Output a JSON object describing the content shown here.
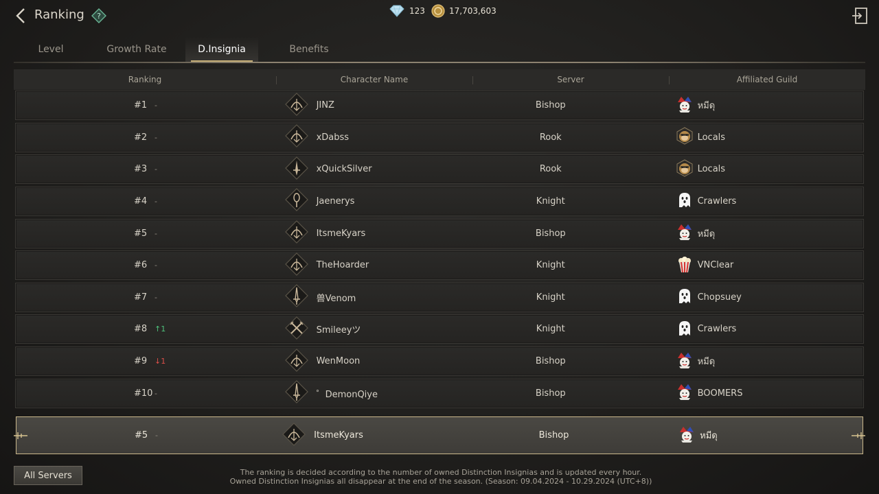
{
  "header": {
    "title": "Ranking",
    "diamonds": "123",
    "gold": "17,703,603"
  },
  "tabs": [
    {
      "label": "Level",
      "active": false
    },
    {
      "label": "Growth Rate",
      "active": false
    },
    {
      "label": "D.Insignia",
      "active": true
    },
    {
      "label": "Benefits",
      "active": false
    }
  ],
  "table": {
    "headers": [
      "Ranking",
      "Character Name",
      "Server",
      "Affiliated Guild"
    ],
    "rows": [
      {
        "rank": "#1",
        "change": "-",
        "change_dir": "none",
        "class_icon": "bow-class-icon",
        "name": "JINZ",
        "server": "Bishop",
        "guild_icon": "jester-icon",
        "guild": "หมีดุ"
      },
      {
        "rank": "#2",
        "change": "-",
        "change_dir": "none",
        "class_icon": "bow-class-icon",
        "name": "xDabss",
        "server": "Rook",
        "guild_icon": "monkey-icon",
        "guild": "Locals"
      },
      {
        "rank": "#3",
        "change": "-",
        "change_dir": "none",
        "class_icon": "dagger-class-icon",
        "name": "xQuickSilver",
        "server": "Rook",
        "guild_icon": "monkey-icon",
        "guild": "Locals"
      },
      {
        "rank": "#4",
        "change": "-",
        "change_dir": "none",
        "class_icon": "staff-class-icon",
        "name": "Jaenerys",
        "server": "Knight",
        "guild_icon": "ghost-icon",
        "guild": "Crawlers"
      },
      {
        "rank": "#5",
        "change": "-",
        "change_dir": "none",
        "class_icon": "bow-class-icon",
        "name": "ItsmeKyars",
        "server": "Bishop",
        "guild_icon": "jester-icon",
        "guild": "หมีดุ"
      },
      {
        "rank": "#6",
        "change": "-",
        "change_dir": "none",
        "class_icon": "bow-class-icon",
        "name": "TheHoarder",
        "server": "Knight",
        "guild_icon": "popcorn-icon",
        "guild": "VNClear"
      },
      {
        "rank": "#7",
        "change": "-",
        "change_dir": "none",
        "class_icon": "sword-class-icon",
        "name": "兽Venom",
        "server": "Knight",
        "guild_icon": "ghost-icon",
        "guild": "Chopsuey"
      },
      {
        "rank": "#8",
        "change": "↑1",
        "change_dir": "up",
        "class_icon": "crossed-blades-class-icon",
        "name": "Smileeyツ",
        "server": "Knight",
        "guild_icon": "ghost-icon",
        "guild": "Crawlers"
      },
      {
        "rank": "#9",
        "change": "↓1",
        "change_dir": "down",
        "class_icon": "bow-class-icon",
        "name": "WenMoon",
        "server": "Bishop",
        "guild_icon": "jester-icon",
        "guild": "หมีดุ"
      },
      {
        "rank": "#10",
        "change": "-",
        "change_dir": "none",
        "class_icon": "sword-class-icon",
        "name": "゜DemonQiye",
        "server": "Bishop",
        "guild_icon": "jester-icon",
        "guild": "BOOMERS"
      }
    ]
  },
  "my_rank": {
    "rank": "#5",
    "change": "-",
    "class_icon": "bow-class-icon",
    "name": "ItsmeKyars",
    "server": "Bishop",
    "guild_icon": "jester-icon",
    "guild": "หมีดุ"
  },
  "footer": {
    "all_servers_label": "All Servers",
    "note_line1": "The ranking is decided according to the number of owned Distinction Insignias and is updated every hour.",
    "note_line2": "Owned Distinction Insignias all disappear at the end of the season. (Season: 09.04.2024 - 10.29.2024 (UTC+8))"
  },
  "colors": {
    "accent": "#c9b27a",
    "rank_up": "#4fc47d",
    "rank_down": "#e0504a",
    "panel": "#2b2a28"
  }
}
